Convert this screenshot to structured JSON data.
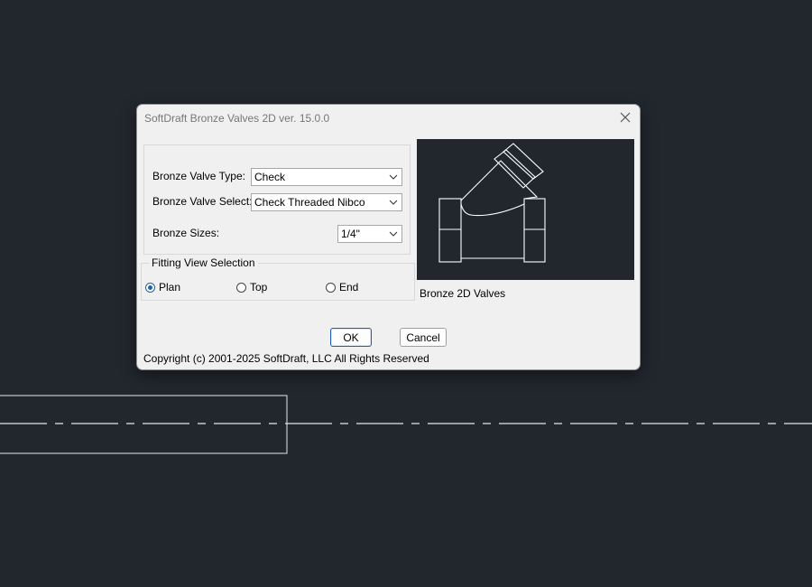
{
  "dialog": {
    "title": "SoftDraft Bronze Valves 2D ver. 15.0.0",
    "fields": {
      "valve_type_label": "Bronze Valve Type:",
      "valve_type_value": "Check",
      "valve_select_label": "Bronze Valve Select:",
      "valve_select_value": "Check Threaded Nibco",
      "sizes_label": "Bronze Sizes:",
      "sizes_value": "1/4\""
    },
    "view_selection": {
      "title": "Fitting View Selection",
      "options": [
        "Plan",
        "Top",
        "End"
      ],
      "selected": "Plan"
    },
    "preview_caption": "Bronze 2D Valves",
    "ok_label": "OK",
    "cancel_label": "Cancel",
    "copyright": "Copyright (c) 2001-2025 SoftDraft, LLC All Rights Reserved"
  },
  "colors": {
    "background": "#22272e",
    "dialog_bg": "#f0f0f0",
    "accent": "#1f5fae",
    "preview_line": "#ffffff"
  }
}
